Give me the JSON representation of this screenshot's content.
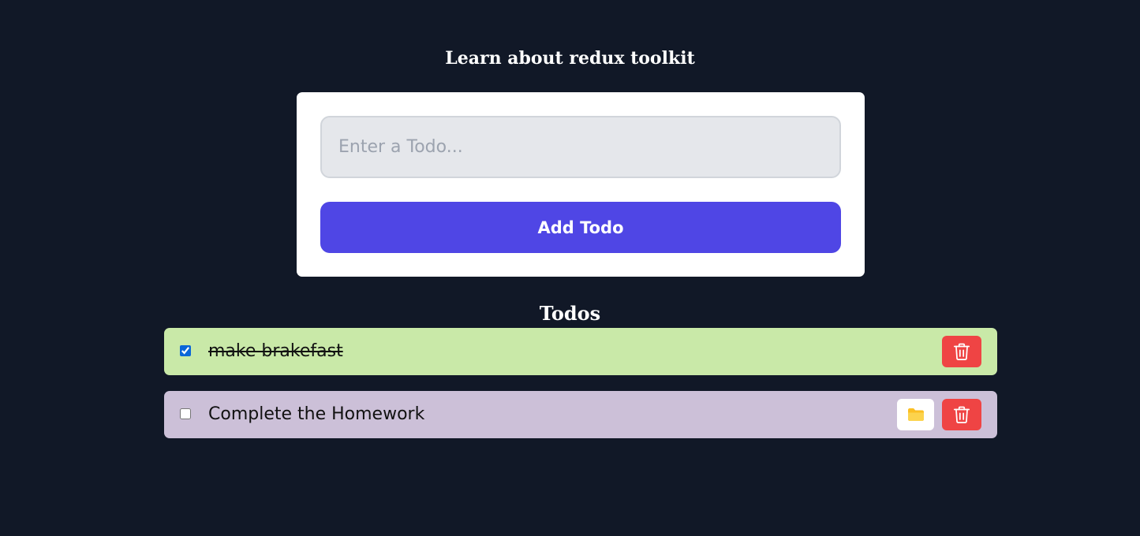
{
  "header": {
    "title": "Learn about redux toolkit"
  },
  "form": {
    "input_value": "",
    "input_placeholder": "Enter a Todo...",
    "add_button_label": "Add Todo"
  },
  "todos_section": {
    "heading": "Todos",
    "items": [
      {
        "text": "make brakefast",
        "completed": true,
        "background_color": "#c9e9a8",
        "actions": [
          "delete"
        ]
      },
      {
        "text": "Complete the Homework",
        "completed": false,
        "background_color": "#ccc0d8",
        "actions": [
          "edit",
          "delete"
        ]
      }
    ]
  },
  "icons": {
    "edit": "folder-icon",
    "delete": "trash-icon"
  },
  "colors": {
    "page_background": "#111827",
    "accent": "#4f46e5",
    "delete": "#ef4444",
    "folder": "#fbbf24"
  }
}
